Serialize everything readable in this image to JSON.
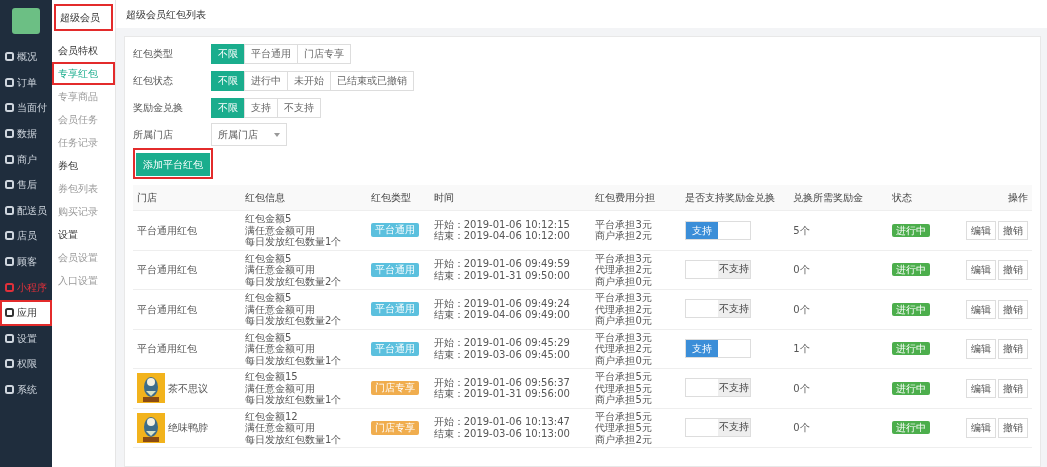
{
  "sidebar": {
    "items": [
      {
        "label": "概况",
        "selected": false,
        "annotated": false
      },
      {
        "label": "订单",
        "selected": false,
        "annotated": false
      },
      {
        "label": "当面付",
        "selected": false,
        "annotated": false
      },
      {
        "label": "数据",
        "selected": false,
        "annotated": false
      },
      {
        "label": "商户",
        "selected": false,
        "annotated": false
      },
      {
        "label": "售后",
        "selected": false,
        "annotated": false
      },
      {
        "label": "配送员",
        "selected": false,
        "annotated": false
      },
      {
        "label": "店员",
        "selected": false,
        "annotated": false
      },
      {
        "label": "顾客",
        "selected": false,
        "annotated": false
      },
      {
        "label": "小程序",
        "selected": false,
        "annotated": false,
        "color": "#e0303a"
      },
      {
        "label": "应用",
        "selected": true,
        "annotated": true
      },
      {
        "label": "设置",
        "selected": false,
        "annotated": false
      },
      {
        "label": "权限",
        "selected": false,
        "annotated": false
      },
      {
        "label": "系统",
        "selected": false,
        "annotated": false
      }
    ]
  },
  "submenu": {
    "title": {
      "label": "超级会员",
      "annotated": true
    },
    "groups": [
      {
        "heading": "会员特权",
        "items": [
          {
            "label": "专享红包",
            "selected": true,
            "annotated": true
          },
          {
            "label": "专享商品",
            "selected": false,
            "annotated": false
          },
          {
            "label": "会员任务",
            "selected": false,
            "annotated": false
          },
          {
            "label": "任务记录",
            "selected": false,
            "annotated": false
          }
        ]
      },
      {
        "heading": "券包",
        "items": [
          {
            "label": "券包列表",
            "selected": false,
            "annotated": false
          },
          {
            "label": "购买记录",
            "selected": false,
            "annotated": false
          }
        ]
      },
      {
        "heading": "设置",
        "items": [
          {
            "label": "会员设置",
            "selected": false,
            "annotated": false
          },
          {
            "label": "入口设置",
            "selected": false,
            "annotated": false
          }
        ]
      }
    ]
  },
  "page_title": "超级会员红包列表",
  "filters": [
    {
      "label": "红包类型",
      "options": [
        {
          "label": "不限",
          "selected": true
        },
        {
          "label": "平台通用",
          "selected": false
        },
        {
          "label": "门店专享",
          "selected": false
        }
      ]
    },
    {
      "label": "红包状态",
      "options": [
        {
          "label": "不限",
          "selected": true
        },
        {
          "label": "进行中",
          "selected": false
        },
        {
          "label": "未开始",
          "selected": false
        },
        {
          "label": "已结束或已撤销",
          "selected": false
        }
      ]
    },
    {
      "label": "奖励金兑换",
      "options": [
        {
          "label": "不限",
          "selected": true
        },
        {
          "label": "支持",
          "selected": false
        },
        {
          "label": "不支持",
          "selected": false
        }
      ]
    }
  ],
  "store_select": {
    "label": "所属门店",
    "value": "所属门店"
  },
  "add_button": {
    "label": "添加平台红包",
    "annotated": true
  },
  "table": {
    "columns": [
      "门店",
      "红包信息",
      "红包类型",
      "时间",
      "红包费用分担",
      "是否支持奖励金兑换",
      "兑换所需奖励金",
      "状态",
      "操作"
    ],
    "rows": [
      {
        "store": "平台通用红包",
        "store_picture": false,
        "info": [
          "红包金额5",
          "满任意金额可用",
          "每日发放红包数量1个"
        ],
        "type": {
          "label": "平台通用",
          "color": "#5bc0de"
        },
        "time": [
          "开始：2019-01-06 10:12:15",
          "结束：2019-04-06 10:12:00"
        ],
        "cost": [
          "平台承担3元",
          "商户承担2元"
        ],
        "exchange": {
          "label": "支持",
          "on": true
        },
        "reward": "5个",
        "status": "进行中",
        "actions": [
          "编辑",
          "撤销"
        ]
      },
      {
        "store": "平台通用红包",
        "store_picture": false,
        "info": [
          "红包金额5",
          "满任意金额可用",
          "每日发放红包数量2个"
        ],
        "type": {
          "label": "平台通用",
          "color": "#5bc0de"
        },
        "time": [
          "开始：2019-01-06 09:49:59",
          "结束：2019-01-31 09:50:00"
        ],
        "cost": [
          "平台承担3元",
          "代理承担2元",
          "商户承担0元"
        ],
        "exchange": {
          "label": "不支持",
          "on": false
        },
        "reward": "0个",
        "status": "进行中",
        "actions": [
          "编辑",
          "撤销"
        ]
      },
      {
        "store": "平台通用红包",
        "store_picture": false,
        "info": [
          "红包金额5",
          "满任意金额可用",
          "每日发放红包数量2个"
        ],
        "type": {
          "label": "平台通用",
          "color": "#5bc0de"
        },
        "time": [
          "开始：2019-01-06 09:49:24",
          "结束：2019-04-06 09:49:00"
        ],
        "cost": [
          "平台承担3元",
          "代理承担2元",
          "商户承担0元"
        ],
        "exchange": {
          "label": "不支持",
          "on": false
        },
        "reward": "0个",
        "status": "进行中",
        "actions": [
          "编辑",
          "撤销"
        ]
      },
      {
        "store": "平台通用红包",
        "store_picture": false,
        "info": [
          "红包金额5",
          "满任意金额可用",
          "每日发放红包数量1个"
        ],
        "type": {
          "label": "平台通用",
          "color": "#5bc0de"
        },
        "time": [
          "开始：2019-01-06 09:45:29",
          "结束：2019-03-06 09:45:00"
        ],
        "cost": [
          "平台承担3元",
          "代理承担2元",
          "商户承担0元"
        ],
        "exchange": {
          "label": "支持",
          "on": true
        },
        "reward": "1个",
        "status": "进行中",
        "actions": [
          "编辑",
          "撤销"
        ]
      },
      {
        "store": "茶不思议",
        "store_picture": true,
        "info": [
          "红包金额15",
          "满任意金额可用",
          "每日发放红包数量1个"
        ],
        "type": {
          "label": "门店专享",
          "color": "#f0ad4e"
        },
        "time": [
          "开始：2019-01-06 09:56:37",
          "结束：2019-01-31 09:56:00"
        ],
        "cost": [
          "平台承担5元",
          "代理承担5元",
          "商户承担5元"
        ],
        "exchange": {
          "label": "不支持",
          "on": false
        },
        "reward": "0个",
        "status": "进行中",
        "actions": [
          "编辑",
          "撤销"
        ]
      },
      {
        "store": "绝味鸭脖",
        "store_picture": true,
        "info": [
          "红包金额12",
          "满任意金额可用",
          "每日发放红包数量1个"
        ],
        "type": {
          "label": "门店专享",
          "color": "#f0ad4e"
        },
        "time": [
          "开始：2019-01-06 10:13:47",
          "结束：2019-03-06 10:13:00"
        ],
        "cost": [
          "平台承担5元",
          "代理承担5元",
          "商户承担2元"
        ],
        "exchange": {
          "label": "不支持",
          "on": false
        },
        "reward": "0个",
        "status": "进行中",
        "actions": [
          "编辑",
          "撤销"
        ]
      }
    ]
  }
}
